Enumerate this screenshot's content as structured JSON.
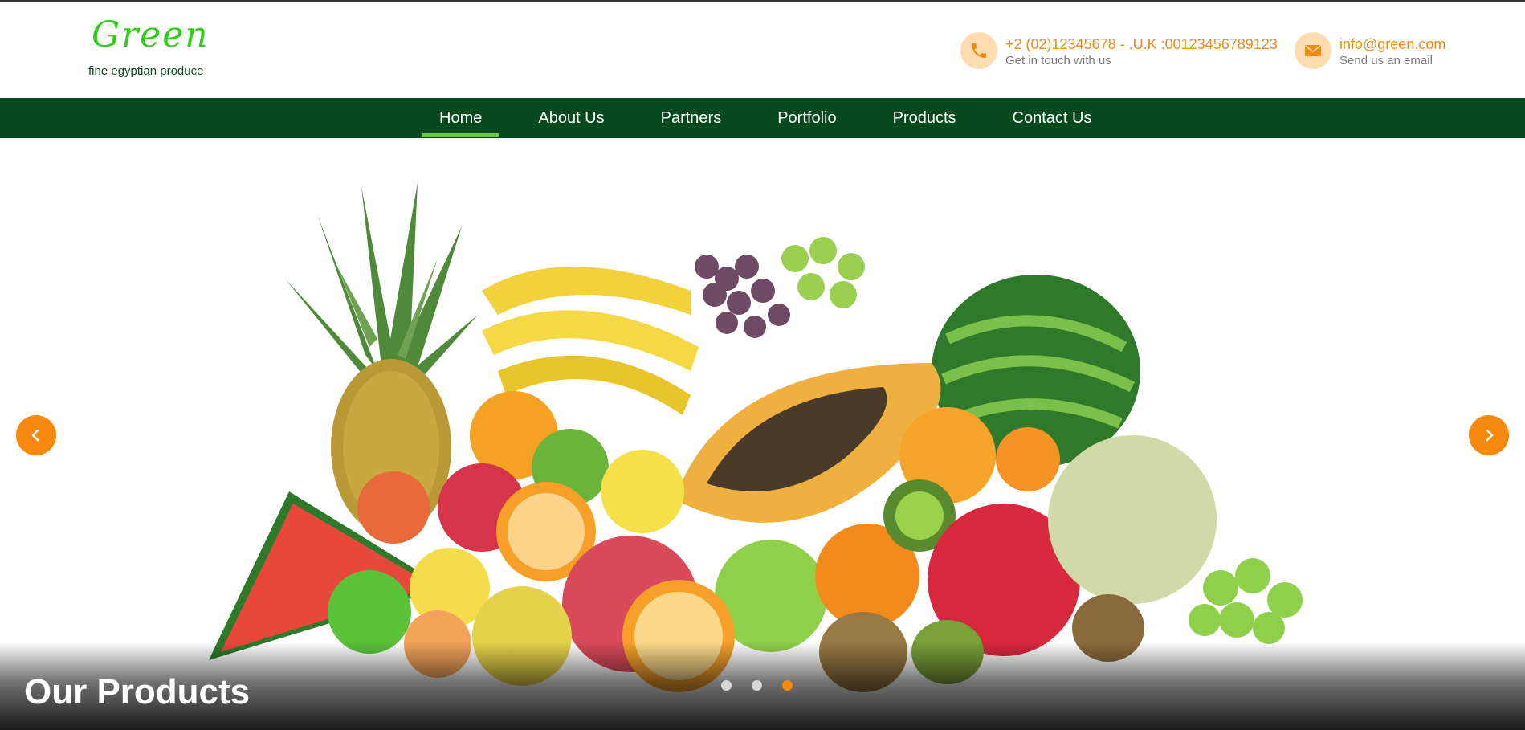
{
  "brand": {
    "name": "Green",
    "tagline": "fine egyptian produce"
  },
  "contacts": {
    "phone": {
      "main": "+2 (02)12345678 - .U.K :00123456789123",
      "sub": "Get in touch with us",
      "icon": "phone-icon"
    },
    "email": {
      "main": "info@green.com",
      "sub": "Send us an email",
      "icon": "envelope-icon"
    }
  },
  "nav": {
    "items": [
      {
        "label": "Home",
        "active": true
      },
      {
        "label": "About Us"
      },
      {
        "label": "Partners"
      },
      {
        "label": "Portfolio"
      },
      {
        "label": "Products"
      },
      {
        "label": "Contact Us"
      }
    ]
  },
  "hero": {
    "title": "Our Products",
    "slide_count": 3,
    "active_slide": 3,
    "prev_icon": "chevron-left-icon",
    "next_icon": "chevron-right-icon"
  },
  "colors": {
    "brand_green": "#33cc1a",
    "nav_green": "#05491d",
    "accent_orange": "#f5880f",
    "nav_active_underline": "#6fc93a"
  }
}
